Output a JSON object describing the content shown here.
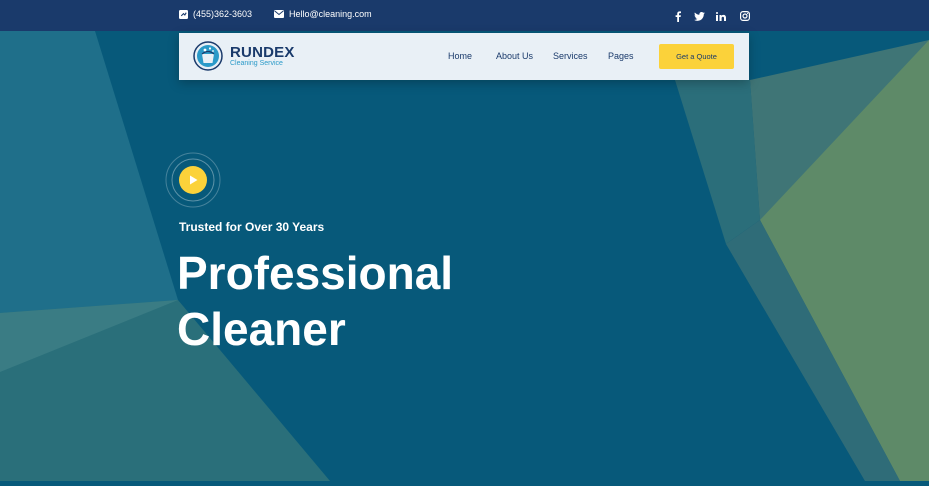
{
  "topbar": {
    "phone": "(455)362-3603",
    "phone_icon": "phone-icon",
    "email": "Hello@cleaning.com",
    "email_icon": "envelope-icon",
    "social": [
      "facebook-icon",
      "twitter-icon",
      "linkedin-icon",
      "instagram-icon"
    ]
  },
  "brand": {
    "name": "RUNDEX",
    "tagline": "Cleaning Service",
    "logo_icon": "cleaning-bucket-logo"
  },
  "nav": {
    "items": [
      {
        "label": "Home"
      },
      {
        "label": "About Us"
      },
      {
        "label": "Services"
      },
      {
        "label": "Pages"
      }
    ],
    "cta_label": "Get a Quote"
  },
  "hero": {
    "tagline": "Trusted for Over 30 Years",
    "headline_line1": "Professional",
    "headline_line2": "Cleaner",
    "play_icon": "play-icon"
  },
  "colors": {
    "topbar": "#1a3a6b",
    "hero_background": "#07597a",
    "accent_yellow": "#fbd23a",
    "navbar_background": "#e9f0f6",
    "brand_blue": "#2b9ac8"
  }
}
